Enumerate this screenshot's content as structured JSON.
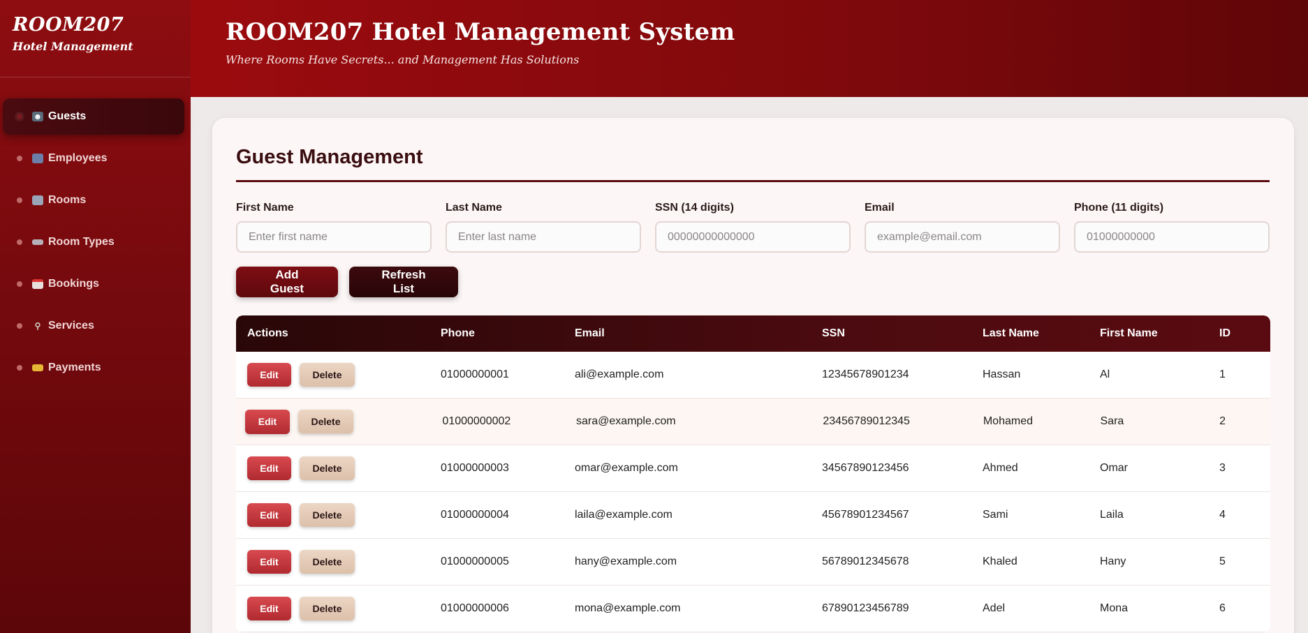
{
  "sidebar": {
    "brand_title": "ROOM207",
    "brand_subtitle": "Hotel Management",
    "items": [
      {
        "label": "Guests",
        "icon": "guests-icon",
        "active": true
      },
      {
        "label": "Employees",
        "icon": "employees-icon",
        "active": false
      },
      {
        "label": "Rooms",
        "icon": "hotel-icon",
        "active": false
      },
      {
        "label": "Room Types",
        "icon": "bed-icon",
        "active": false
      },
      {
        "label": "Bookings",
        "icon": "calendar-icon",
        "active": false
      },
      {
        "label": "Services",
        "icon": "wrench-icon",
        "active": false
      },
      {
        "label": "Payments",
        "icon": "credit-card-icon",
        "active": false
      }
    ]
  },
  "header": {
    "title": "ROOM207 Hotel Management System",
    "subtitle": "Where Rooms Have Secrets... and Management Has Solutions"
  },
  "main": {
    "title": "Guest Management",
    "form": {
      "first_name": {
        "label": "First Name",
        "placeholder": "Enter first name"
      },
      "last_name": {
        "label": "Last Name",
        "placeholder": "Enter last name"
      },
      "ssn": {
        "label": "SSN (14 digits)",
        "placeholder": "00000000000000"
      },
      "email": {
        "label": "Email",
        "placeholder": "example@email.com"
      },
      "phone": {
        "label": "Phone (11 digits)",
        "placeholder": "01000000000"
      }
    },
    "buttons": {
      "add": "Add Guest",
      "refresh": "Refresh List"
    },
    "table": {
      "headers": [
        "Actions",
        "Phone",
        "Email",
        "SSN",
        "Last Name",
        "First Name",
        "ID"
      ],
      "edit_label": "Edit",
      "delete_label": "Delete",
      "rows": [
        {
          "phone": "01000000001",
          "email": "ali@example.com",
          "ssn": "12345678901234",
          "last": "Hassan",
          "first": "Al",
          "id": "1"
        },
        {
          "phone": "01000000002",
          "email": "sara@example.com",
          "ssn": "23456789012345",
          "last": "Mohamed",
          "first": "Sara",
          "id": "2"
        },
        {
          "phone": "01000000003",
          "email": "omar@example.com",
          "ssn": "34567890123456",
          "last": "Ahmed",
          "first": "Omar",
          "id": "3"
        },
        {
          "phone": "01000000004",
          "email": "laila@example.com",
          "ssn": "45678901234567",
          "last": "Sami",
          "first": "Laila",
          "id": "4"
        },
        {
          "phone": "01000000005",
          "email": "hany@example.com",
          "ssn": "56789012345678",
          "last": "Khaled",
          "first": "Hany",
          "id": "5"
        },
        {
          "phone": "01000000006",
          "email": "mona@example.com",
          "ssn": "67890123456789",
          "last": "Adel",
          "first": "Mona",
          "id": "6"
        }
      ]
    }
  },
  "colors": {
    "brand_red": "#8e0d10",
    "dark_maroon": "#3a070b",
    "edit_red": "#c2363c",
    "delete_beige": "#e4cab6"
  }
}
